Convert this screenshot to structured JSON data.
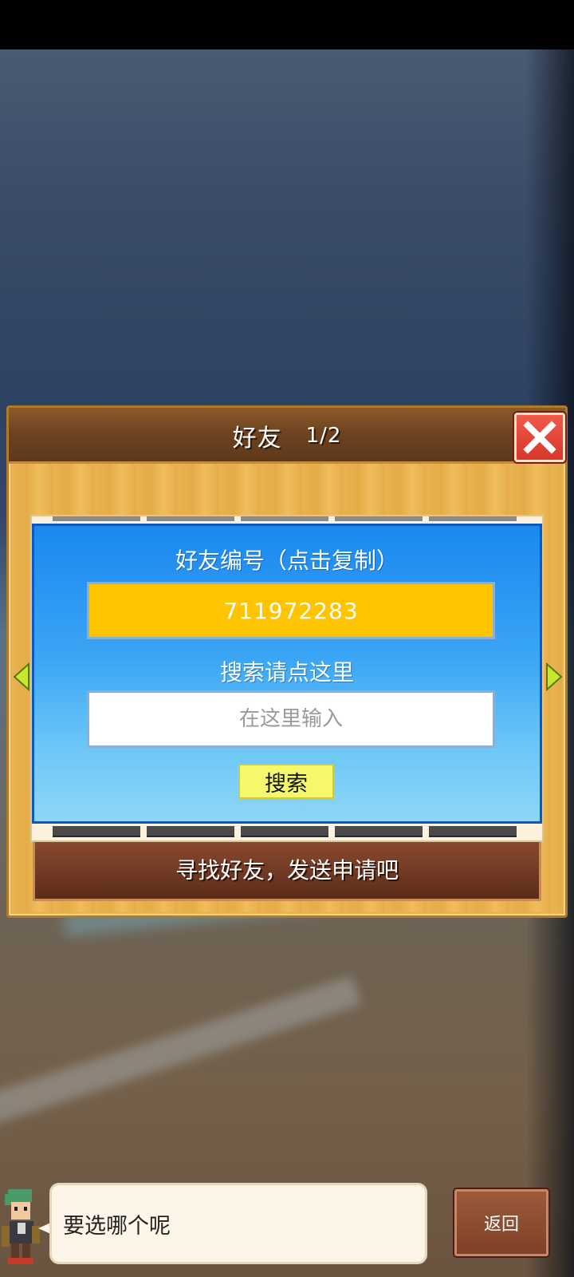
{
  "dialog": {
    "title": "好友",
    "page": "1/2",
    "close_icon": "close-x-icon"
  },
  "friend_id": {
    "label": "好友编号（点击复制）",
    "value": "711972283"
  },
  "search": {
    "label": "搜索请点这里",
    "placeholder": "在这里输入",
    "button_label": "搜索"
  },
  "find_friends": {
    "label": "寻找好友，发送申请吧"
  },
  "footer": {
    "prompt": "要选哪个呢",
    "back_label": "返回"
  },
  "colors": {
    "accent_yellow": "#ffc400",
    "panel_blue": "#1a88f0",
    "close_red": "#e0402f"
  }
}
